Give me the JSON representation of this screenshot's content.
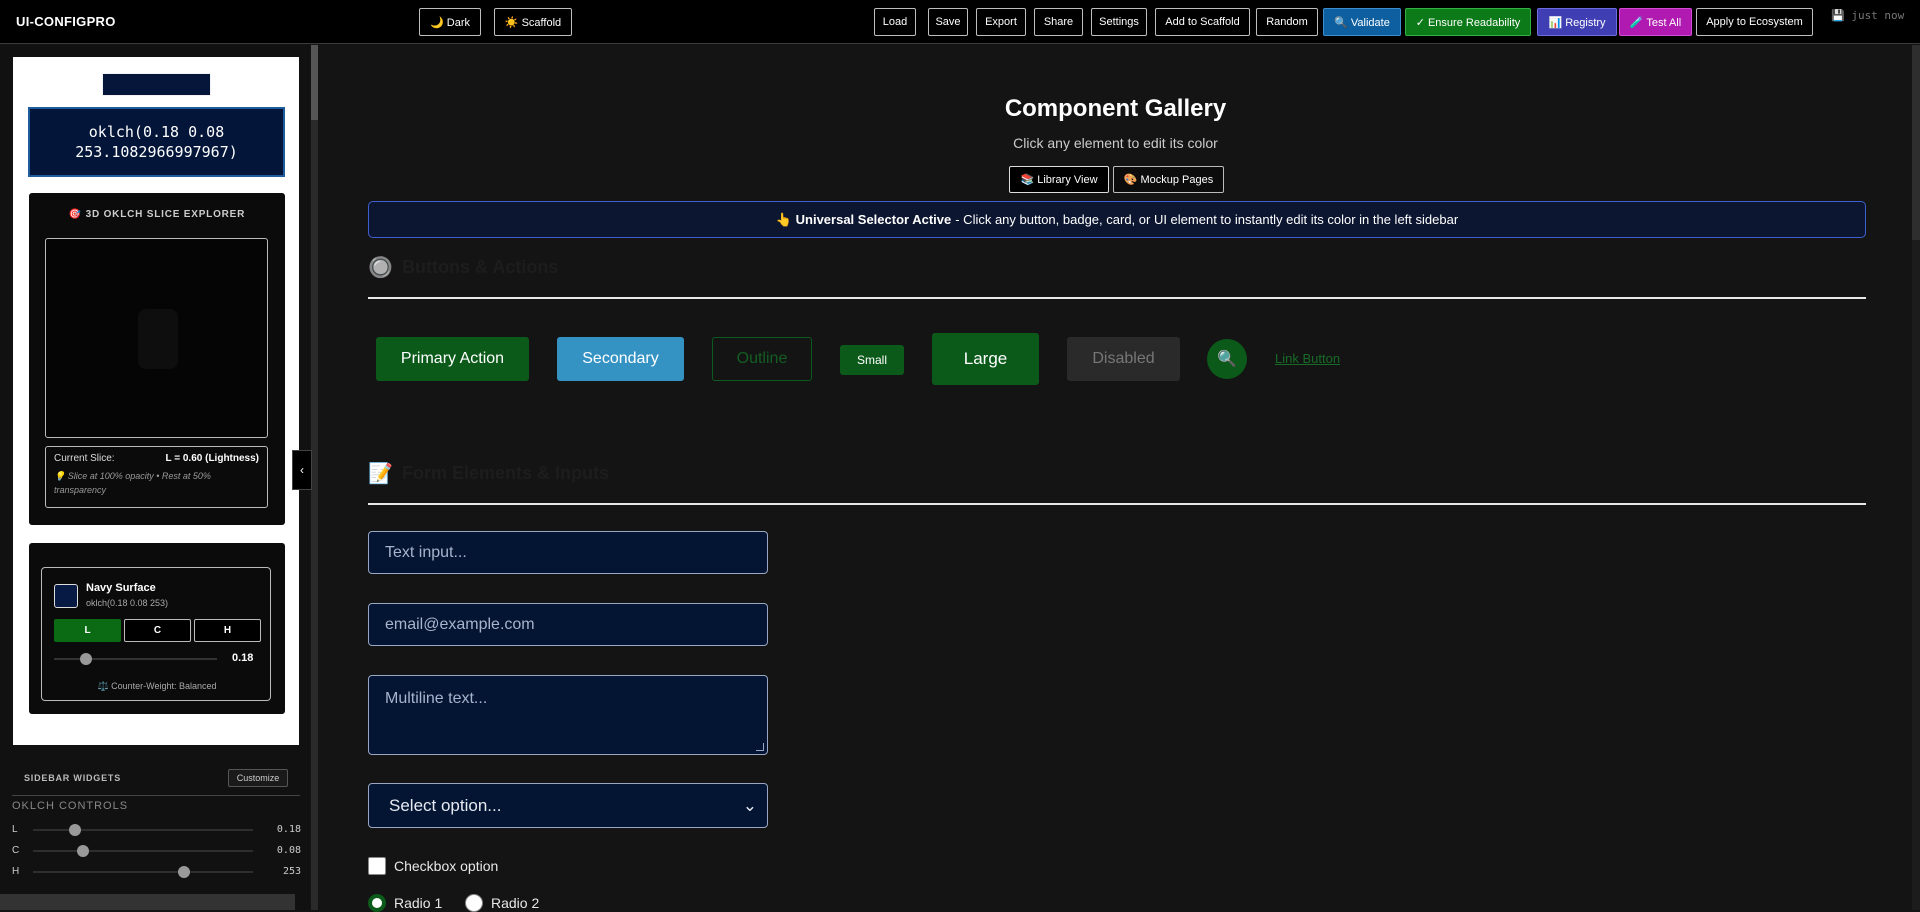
{
  "app": {
    "title": "UI-CONFIGPRO",
    "saved_status": "💾 just now"
  },
  "toolbar": {
    "dark": "🌙 Dark",
    "scaffold": "☀️ Scaffold",
    "load": "Load",
    "save": "Save",
    "export": "Export",
    "share": "Share",
    "settings": "Settings",
    "add_to_scaffold": "Add to Scaffold",
    "random": "Random",
    "validate": "🔍 Validate",
    "ensure_readability": "✓ Ensure Readability",
    "registry": "📊 Registry",
    "test_all": "🧪 Test All",
    "apply_ecosystem": "Apply to Ecosystem"
  },
  "sidebar": {
    "color_value": "oklch(0.18 0.08 253.1082966997967)",
    "explorer": {
      "title": "🎯 3D OKLCH SLICE EXPLORER",
      "current_slice_label": "Current Slice:",
      "current_slice_value": "L = 0.60 (Lightness)",
      "note": "💡 Slice at 100% opacity • Rest at 50% transparency"
    },
    "widget": {
      "name": "Navy Surface",
      "value": "oklch(0.18 0.08 253)",
      "tabs": [
        "L",
        "C",
        "H"
      ],
      "slider_value": "0.18",
      "slider_fraction": 0.18,
      "balance": "⚖️ Counter-Weight: Balanced"
    },
    "widgets_label": "SIDEBAR WIDGETS",
    "customize": "Customize",
    "controls_title": "OKLCH CONTROLS",
    "controls": [
      {
        "label": "L",
        "value": "0.18",
        "fraction": 0.18
      },
      {
        "label": "C",
        "value": "0.08",
        "fraction": 0.22
      },
      {
        "label": "H",
        "value": "253",
        "fraction": 0.7
      }
    ],
    "collapse": "‹"
  },
  "main": {
    "title": "Component Gallery",
    "subtitle": "Click any element to edit its color",
    "views": [
      "📚 Library View",
      "🎨 Mockup Pages"
    ],
    "banner_bold": "👆 Universal Selector Active",
    "banner_rest": "- Click any button, badge, card, or UI element to instantly edit its color in the left sidebar",
    "section_buttons": {
      "icon": "🔘",
      "title": "Buttons & Actions"
    },
    "buttons": {
      "primary": "Primary Action",
      "secondary": "Secondary",
      "outline": "Outline",
      "small": "Small",
      "large": "Large",
      "disabled": "Disabled",
      "icon": "🔍",
      "link": "Link Button"
    },
    "section_forms": {
      "icon": "📝",
      "title": "Form Elements & Inputs"
    },
    "forms": {
      "text_placeholder": "Text input...",
      "email_placeholder": "email@example.com",
      "textarea_placeholder": "Multiline text...",
      "select_value": "Select option...",
      "checkbox_label": "Checkbox option",
      "radio1": "Radio 1",
      "radio2": "Radio 2"
    }
  },
  "colors": {
    "accent_green": "#0b5a1a",
    "secondary_blue": "#3593c4",
    "navy_surface": "#041433",
    "validate_blue": "#0d5fa0",
    "readability_green": "#0c7a18",
    "registry_indigo": "#3f3fb3",
    "test_magenta": "#b01ab0"
  }
}
